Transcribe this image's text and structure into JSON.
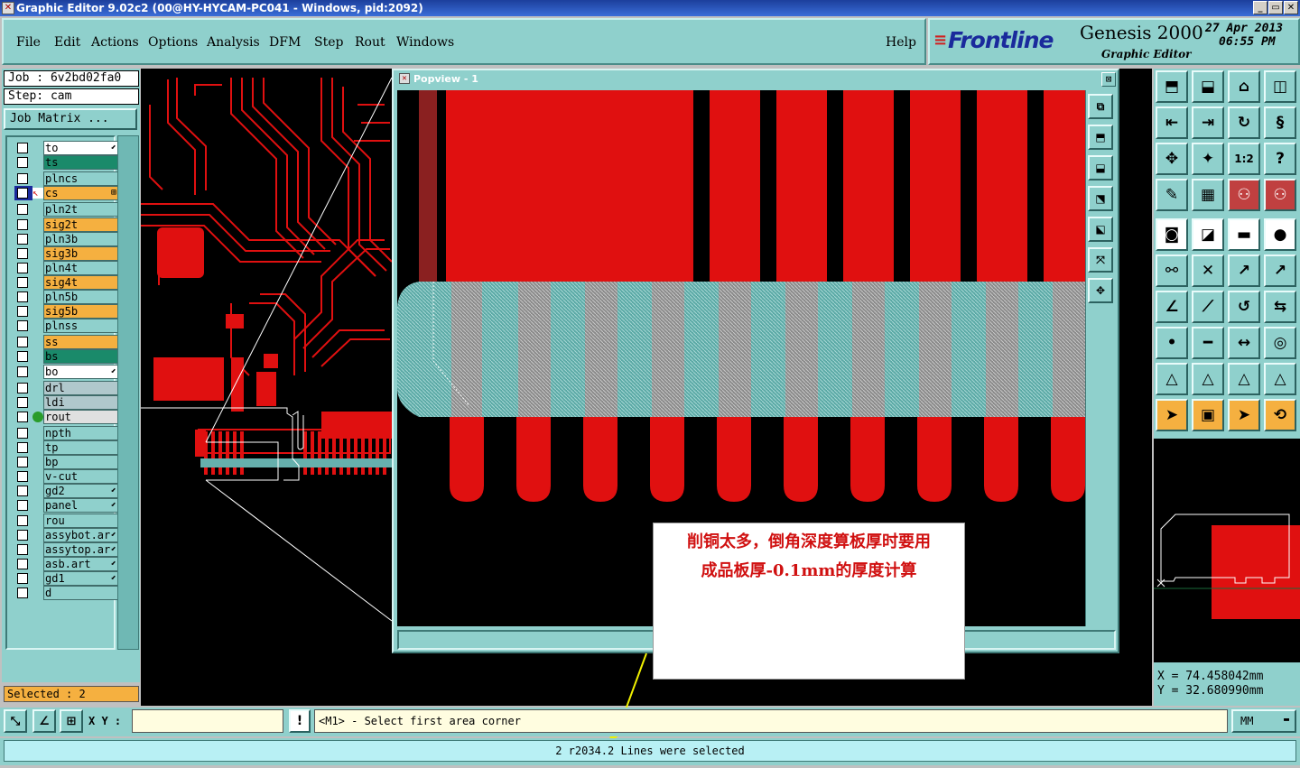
{
  "window": {
    "title": "Graphic Editor 9.02c2 (00@HY-HYCAM-PC041 - Windows, pid:2092)",
    "buttons": [
      "_",
      "▭",
      "✕"
    ]
  },
  "menu": {
    "items": [
      "File",
      "Edit",
      "Actions",
      "Options",
      "Analysis",
      "DFM",
      "Step",
      "Rout",
      "Windows"
    ],
    "help": "Help"
  },
  "brand": {
    "logo": "Frontline",
    "product": "Genesis 2000",
    "subtitle": "Graphic Editor",
    "date": "27 Apr 2013",
    "time": "06:55 PM"
  },
  "job": {
    "job_label": "Job : 6v2bd02fa0",
    "step_label": "Step: cam",
    "matrix_button": "Job Matrix ..."
  },
  "layers": [
    {
      "name": "to",
      "color": "#ffffff",
      "mark": "⬋"
    },
    {
      "name": "ts",
      "color": "#1a8a6a",
      "mark": ""
    },
    {
      "name": "plncs",
      "color": "#8fd0cc",
      "mark": ""
    },
    {
      "name": "cs",
      "color": "#f5b040",
      "mark": "⊞",
      "active": true
    },
    {
      "name": "pln2t",
      "color": "#8fd0cc",
      "mark": ""
    },
    {
      "name": "sig2t",
      "color": "#f5b040",
      "mark": ""
    },
    {
      "name": "pln3b",
      "color": "#8fd0cc",
      "mark": ""
    },
    {
      "name": "sig3b",
      "color": "#f5b040",
      "mark": ""
    },
    {
      "name": "pln4t",
      "color": "#8fd0cc",
      "mark": ""
    },
    {
      "name": "sig4t",
      "color": "#f5b040",
      "mark": ""
    },
    {
      "name": "pln5b",
      "color": "#8fd0cc",
      "mark": ""
    },
    {
      "name": "sig5b",
      "color": "#f5b040",
      "mark": ""
    },
    {
      "name": "plnss",
      "color": "#8fd0cc",
      "mark": ""
    },
    {
      "name": "ss",
      "color": "#f5b040",
      "mark": ""
    },
    {
      "name": "bs",
      "color": "#1a8a6a",
      "mark": ""
    },
    {
      "name": "bo",
      "color": "#ffffff",
      "mark": "⬋"
    },
    {
      "name": "drl",
      "color": "#b0c8cc",
      "mark": ""
    },
    {
      "name": "ldi",
      "color": "#b0c8cc",
      "mark": ""
    },
    {
      "name": "rout",
      "color": "#e0e0e0",
      "mark": "",
      "dot": true
    },
    {
      "name": "npth",
      "color": "#8fd0cc",
      "mark": ""
    },
    {
      "name": "tp",
      "color": "#8fd0cc",
      "mark": ""
    },
    {
      "name": "bp",
      "color": "#8fd0cc",
      "mark": ""
    },
    {
      "name": "v-cut",
      "color": "#8fd0cc",
      "mark": ""
    },
    {
      "name": "gd2",
      "color": "#8fd0cc",
      "mark": "⬋"
    },
    {
      "name": "panel",
      "color": "#8fd0cc",
      "mark": "⬋"
    },
    {
      "name": "rou",
      "color": "#8fd0cc",
      "mark": ""
    },
    {
      "name": "assybot.ar",
      "color": "#8fd0cc",
      "mark": "⬋"
    },
    {
      "name": "assytop.ar",
      "color": "#8fd0cc",
      "mark": "⬋"
    },
    {
      "name": "asb.art",
      "color": "#8fd0cc",
      "mark": "⬋"
    },
    {
      "name": "gd1",
      "color": "#8fd0cc",
      "mark": "⬋"
    },
    {
      "name": "d",
      "color": "#8fd0cc",
      "mark": ""
    }
  ],
  "selected": "Selected : 2",
  "popview": {
    "title": "Popview - 1"
  },
  "annotation": {
    "line1": "削铜太多，倒角深度算板厚时要用",
    "line2": "成品板厚-0.1mm的厚度计算"
  },
  "coords": {
    "x": "X = 74.458042mm",
    "y": "Y = 32.680990mm"
  },
  "cmd": {
    "xy_label": "X Y :",
    "xy_value": "",
    "alert": "!",
    "prompt": "<M1> - Select first area corner",
    "units": "MM"
  },
  "status": "2 r2034.2 Lines were selected",
  "icons": {
    "toolbar": [
      "view-home-icon",
      "view-up-icon",
      "view-house-icon",
      "view-split-icon",
      "pan-left-icon",
      "pan-right-icon",
      "redraw-icon",
      "s-curve-icon",
      "zoom-fit-icon",
      "zoom-center-icon",
      "zoom-1to2-icon",
      "help-icon",
      "measure-tool-icon",
      "grid-icon",
      "layers-icon",
      "layers-alt-icon",
      "select-pad-icon",
      "draw-line-icon",
      "ruler-icon",
      "dot-icon",
      "connect-icon",
      "cross-icon",
      "move-pt-icon",
      "move-pt2-icon",
      "angle-icon",
      "slope-icon",
      "arc-icon",
      "flip-icon",
      "point-icon",
      "segment-icon",
      "distance-icon",
      "cluster-icon",
      "triangle-icon",
      "triangle2-icon",
      "triangle3-icon",
      "triangle4-icon",
      "select-arrow-icon",
      "select-box-icon",
      "select-arrow-box-icon",
      "route-icon"
    ]
  }
}
